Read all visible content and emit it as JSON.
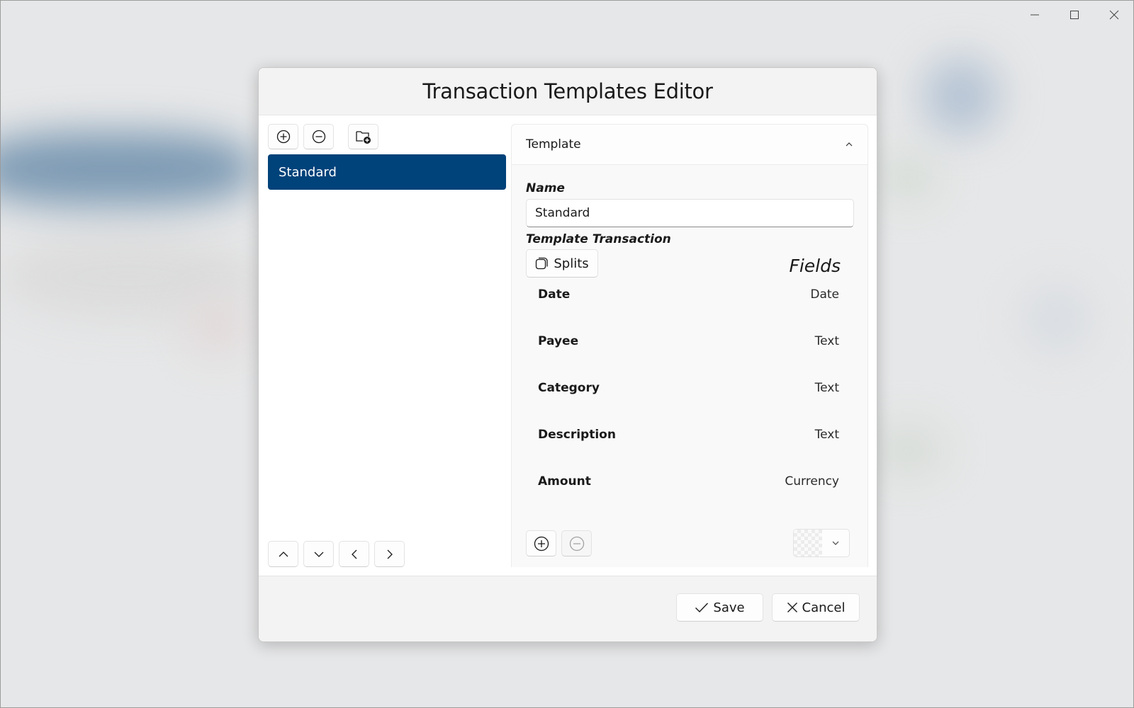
{
  "window": {
    "controls": [
      {
        "name": "minimize",
        "icon": "minimize-icon"
      },
      {
        "name": "maximize",
        "icon": "maximize-icon"
      },
      {
        "name": "close",
        "icon": "close-icon"
      }
    ]
  },
  "dialog": {
    "title": "Transaction Templates Editor",
    "list_toolbar": {
      "add_icon": "add-circle-icon",
      "remove_icon": "remove-circle-icon",
      "new_folder_icon": "folder-add-icon"
    },
    "templates": [
      {
        "label": "Standard",
        "selected": true
      }
    ],
    "nav_buttons": [
      {
        "name": "move-up",
        "icon": "chevron-up-icon"
      },
      {
        "name": "move-down",
        "icon": "chevron-down-icon"
      },
      {
        "name": "move-left",
        "icon": "chevron-left-icon"
      },
      {
        "name": "move-right",
        "icon": "chevron-right-icon"
      }
    ],
    "template_panel": {
      "header": "Template",
      "expanded": true,
      "name_label": "Name",
      "name_value": "Standard",
      "transaction_label": "Template Transaction",
      "splits_label": "Splits",
      "fields_title": "Fields",
      "fields": [
        {
          "name": "Date",
          "type": "Date"
        },
        {
          "name": "Payee",
          "type": "Text"
        },
        {
          "name": "Category",
          "type": "Text"
        },
        {
          "name": "Description",
          "type": "Text"
        },
        {
          "name": "Amount",
          "type": "Currency"
        }
      ],
      "add_field_icon": "add-circle-icon",
      "remove_field_icon": "remove-circle-icon",
      "remove_field_disabled": true,
      "color_picker": {
        "selected": "transparent"
      }
    },
    "footer": {
      "save_label": "Save",
      "cancel_label": "Cancel"
    }
  },
  "colors": {
    "accent": "#00427a",
    "dialog_header_bg": "#f3f3f3",
    "panel_bg": "#f9f9f9"
  }
}
